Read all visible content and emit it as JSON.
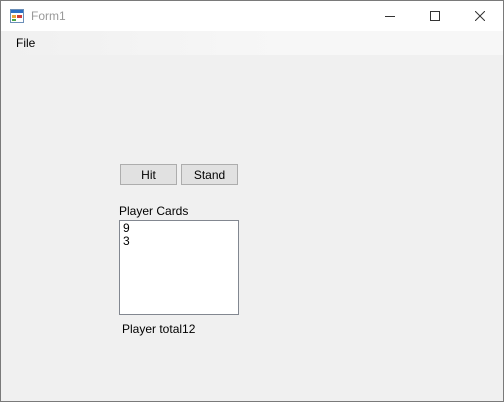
{
  "window": {
    "title": "Form1"
  },
  "menu": {
    "file_label": "File"
  },
  "buttons": {
    "hit_label": "Hit",
    "stand_label": "Stand"
  },
  "player": {
    "cards_label": "Player Cards",
    "cards": [
      "9",
      "3"
    ],
    "total_label": "Player total12"
  },
  "icons": {
    "app": "form-app-icon",
    "minimize": "minimize-icon",
    "maximize": "maximize-icon",
    "close": "close-icon"
  }
}
